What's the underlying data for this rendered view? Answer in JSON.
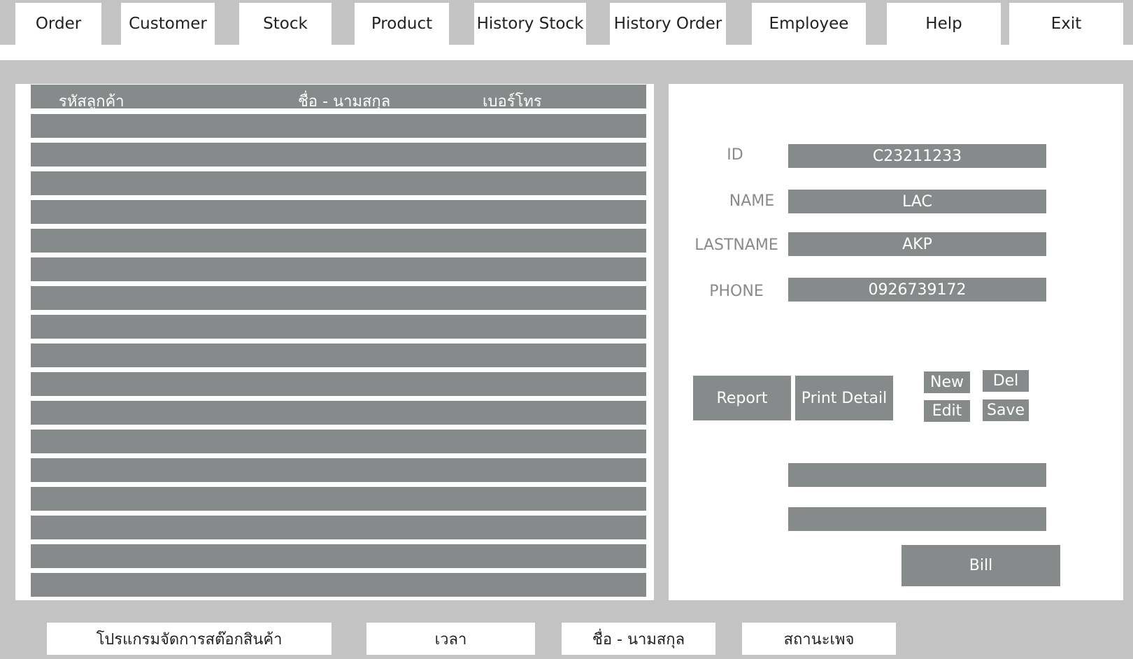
{
  "nav": {
    "tabs": [
      "Order",
      "Customer",
      "Stock",
      "Product",
      "History Stock",
      "History Order",
      "Employee",
      "Help",
      "Exit"
    ]
  },
  "table": {
    "headers": [
      "รหัสลูกค้า",
      "ชื่อ  - นามสกุล",
      "เบอร์โทร"
    ]
  },
  "form": {
    "labels": {
      "id": "ID",
      "name": "NAME",
      "lastname": "LASTNAME",
      "phone": "PHONE"
    },
    "values": {
      "id": "C23211233",
      "name": "LAC",
      "lastname": "AKP",
      "phone": "0926739172"
    },
    "extra1": "",
    "extra2": ""
  },
  "buttons": {
    "report": "Report",
    "print_detail": "Print Detail",
    "new": "New",
    "del": "Del",
    "edit": "Edit",
    "save": "Save",
    "bill": "Bill"
  },
  "footer": {
    "program": "โปรแกรมจัดการสต๊อกสินค้า",
    "time": "เวลา",
    "name": "ชื่อ - นามสกุล",
    "status": "สถานะเพจ"
  },
  "colors": {
    "background": "#c3c3c3",
    "panel": "#ffffff",
    "bar": "#878a8a",
    "label": "#8a8a8a"
  }
}
